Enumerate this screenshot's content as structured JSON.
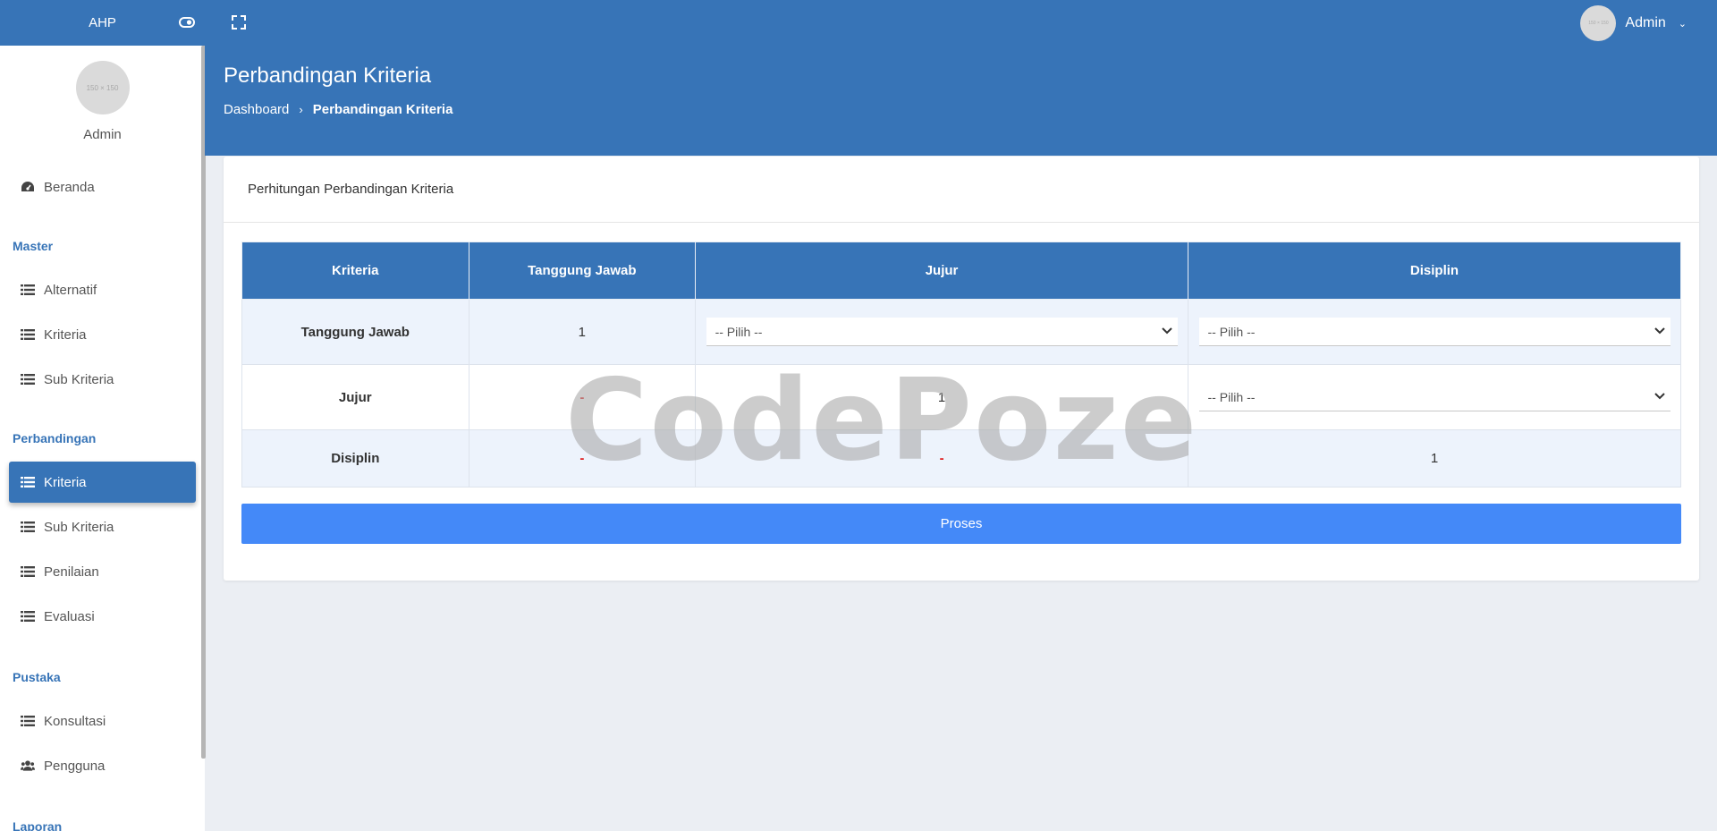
{
  "topbar": {
    "brand": "AHP",
    "toggle_icon": "eye-toggle-icon",
    "fullscreen_icon": "fullscreen-icon",
    "user": {
      "avatar_text": "150 × 150",
      "name": "Admin",
      "chevron": "⌄"
    }
  },
  "sidebar": {
    "profile": {
      "avatar_text": "150 × 150",
      "name": "Admin"
    },
    "home": {
      "label": "Beranda",
      "icon": "dashboard-icon"
    },
    "sections": {
      "master": "Master",
      "perbandingan": "Perbandingan",
      "pustaka": "Pustaka",
      "laporan": "Laporan"
    },
    "master_items": [
      {
        "label": "Alternatif",
        "icon": "list-icon"
      },
      {
        "label": "Kriteria",
        "icon": "list-icon"
      },
      {
        "label": "Sub Kriteria",
        "icon": "list-icon"
      }
    ],
    "perbandingan_items": [
      {
        "label": "Kriteria",
        "icon": "list-icon",
        "active": true
      },
      {
        "label": "Sub Kriteria",
        "icon": "list-icon"
      },
      {
        "label": "Penilaian",
        "icon": "list-icon"
      },
      {
        "label": "Evaluasi",
        "icon": "list-icon"
      }
    ],
    "pustaka_items": [
      {
        "label": "Konsultasi",
        "icon": "list-icon"
      },
      {
        "label": "Pengguna",
        "icon": "users-icon"
      }
    ]
  },
  "header": {
    "title": "Perbandingan Kriteria",
    "breadcrumb": {
      "home": "Dashboard",
      "separator": "›",
      "current": "Perbandingan Kriteria"
    }
  },
  "card": {
    "title": "Perhitungan Perbandingan Kriteria",
    "table": {
      "columns": [
        "Kriteria",
        "Tanggung Jawab",
        "Jujur",
        "Disiplin"
      ],
      "rows": [
        {
          "label": "Tanggung Jawab",
          "cells": [
            "1",
            "-- Pilih --",
            "-- Pilih --"
          ]
        },
        {
          "label": "Jujur",
          "cells": [
            "-",
            "1",
            "-- Pilih --"
          ]
        },
        {
          "label": "Disiplin",
          "cells": [
            "-",
            "-",
            "1"
          ]
        }
      ]
    },
    "submit_label": "Proses"
  },
  "watermark": "CodePoze",
  "colors": {
    "primary": "#3774b7",
    "button": "#4489f8",
    "background": "#ebeef3",
    "dash": "#e02020"
  }
}
